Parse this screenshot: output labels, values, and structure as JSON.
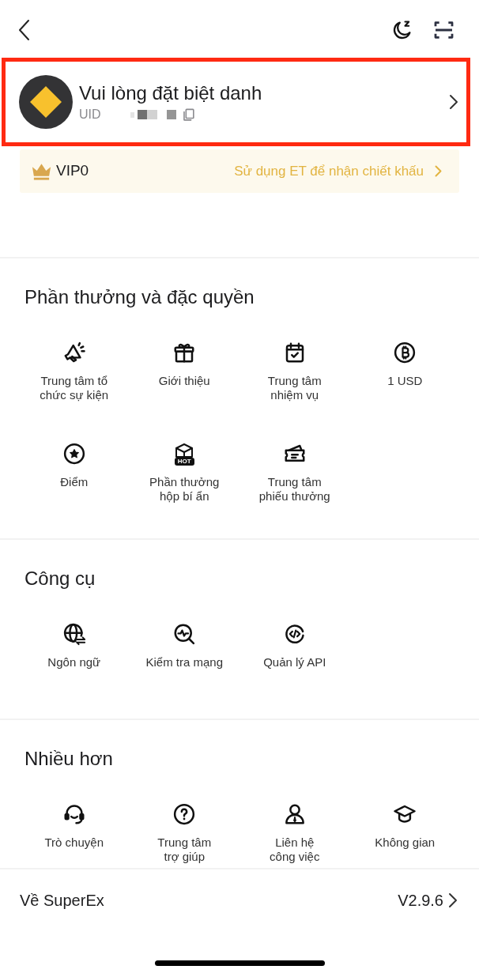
{
  "profile": {
    "nickname": "Vui lòng đặt biệt danh",
    "uid_label": "UID",
    "highlighted": true
  },
  "vip": {
    "tier": "VIP0",
    "promo": "Sử dụng ET để nhận chiết khấu"
  },
  "sections": [
    {
      "title": "Phần thưởng và đặc quyền",
      "items": [
        {
          "label": "Trung tâm tổ\nchức sự kiện"
        },
        {
          "label": "Giới thiệu"
        },
        {
          "label": "Trung tâm\nnhiệm vụ"
        },
        {
          "label": "1 USD"
        },
        {
          "label": "Điểm"
        },
        {
          "label": "Phần thưởng\nhộp bí ẩn",
          "badge": "HOT"
        },
        {
          "label": "Trung tâm\nphiếu thưởng"
        }
      ]
    },
    {
      "title": "Công cụ",
      "items": [
        {
          "label": "Ngôn ngữ"
        },
        {
          "label": "Kiểm tra mạng"
        },
        {
          "label": "Quản lý API"
        }
      ]
    },
    {
      "title": "Nhiều hơn",
      "items": [
        {
          "label": "Trò chuyện"
        },
        {
          "label": "Trung tâm\ntrợ giúp"
        },
        {
          "label": "Liên hệ\ncông việc"
        },
        {
          "label": "Không gian"
        }
      ]
    }
  ],
  "about": {
    "label": "Về SuperEx",
    "version": "V2.9.6"
  }
}
